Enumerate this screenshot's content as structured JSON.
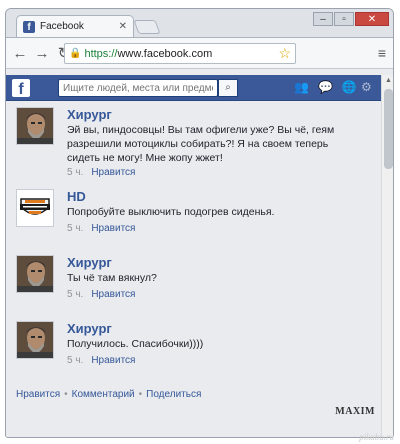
{
  "browser": {
    "tab_title": "Facebook",
    "tab_favicon": "f",
    "url_scheme": "https://",
    "url_host": "www.facebook.com"
  },
  "facebook": {
    "logo": "f",
    "search_placeholder": "Ищите людей, места или предметы"
  },
  "comments": [
    {
      "author": "Хирург",
      "text": "Эй вы, пиндосовцы! Вы там офигели уже? Вы чё, геям разрешили мотоциклы собирать?! Я на своем теперь сидеть не могу! Мне жопу жжет!",
      "time": "5 ч.",
      "like": "Нравится",
      "avatar": "surgeon-avatar"
    },
    {
      "author": "HD",
      "text": "Попробуйте выключить подогрев сиденья.",
      "time": "5 ч.",
      "like": "Нравится",
      "avatar": "harley-davidson-logo"
    },
    {
      "author": "Хирург",
      "text": "Ты чё там вякнул?",
      "time": "5 ч.",
      "like": "Нравится",
      "avatar": "surgeon-avatar"
    },
    {
      "author": "Хирург",
      "text": "Получилось. Спасибочки))))",
      "time": "5 ч.",
      "like": "Нравится",
      "avatar": "surgeon-avatar"
    }
  ],
  "footer": {
    "like": "Нравится",
    "comment": "Комментарий",
    "share": "Поделиться"
  },
  "brand": "MAXIM",
  "watermark": "pikabu.ru",
  "colors": {
    "facebook_blue": "#3b5998",
    "link": "#365899",
    "page_bg": "#e9ebee"
  }
}
